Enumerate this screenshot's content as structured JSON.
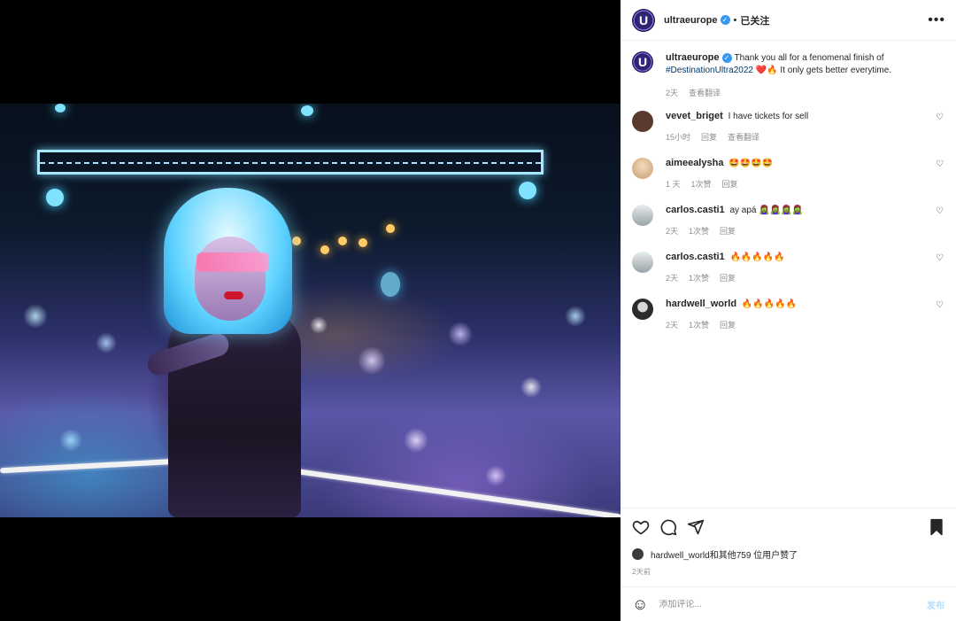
{
  "post": {
    "username": "ultraeurope",
    "follow_status": "已关注",
    "separator": "•",
    "more_glyph": "•••",
    "verified_glyph": "✓"
  },
  "caption": {
    "username": "ultraeurope",
    "text_before": "Thank you all for a fenomenal finish of",
    "hashtag": "#DestinationUltra2022",
    "emojis": "❤️🔥",
    "text_after": "It only gets better everytime.",
    "time": "2天",
    "translate": "查看翻译"
  },
  "comments": [
    {
      "username": "vevet_briget",
      "text": "I have tickets for sell",
      "time": "15小时",
      "likes": "",
      "reply": "回复",
      "translate": "查看翻译",
      "avatar_color": "#5a3a2e"
    },
    {
      "username": "aimeealysha",
      "text": "🤩🤩🤩🤩",
      "time": "1 天",
      "likes": "1次赞",
      "reply": "回复",
      "translate": "",
      "avatar_color": "#d9b58c"
    },
    {
      "username": "carlos.casti1",
      "text": "ay apá 🧟‍♀️🧟‍♀️🧟‍♀️🧟‍♀️",
      "time": "2天",
      "likes": "1次赞",
      "reply": "回复",
      "translate": "",
      "avatar_color": "#9aa3a8"
    },
    {
      "username": "carlos.casti1",
      "text": "🔥🔥🔥🔥🔥",
      "time": "2天",
      "likes": "1次赞",
      "reply": "回复",
      "translate": "",
      "avatar_color": "#9aa3a8"
    },
    {
      "username": "hardwell_world",
      "text": "🔥🔥🔥🔥🔥",
      "time": "2天",
      "likes": "1次赞",
      "reply": "回复",
      "translate": "",
      "avatar_color": "#2b2b2b"
    }
  ],
  "actions": {
    "liked_by": "hardwell_world和其他759 位用户赞了",
    "date": "2天前"
  },
  "add_comment": {
    "placeholder": "添加评论...",
    "post_label": "发布",
    "emoji_glyph": "☺"
  },
  "colors": {
    "accent": "#0095f6",
    "verified": "#3897f0",
    "hashtag": "#00376b",
    "muted": "#8e8e8e"
  }
}
